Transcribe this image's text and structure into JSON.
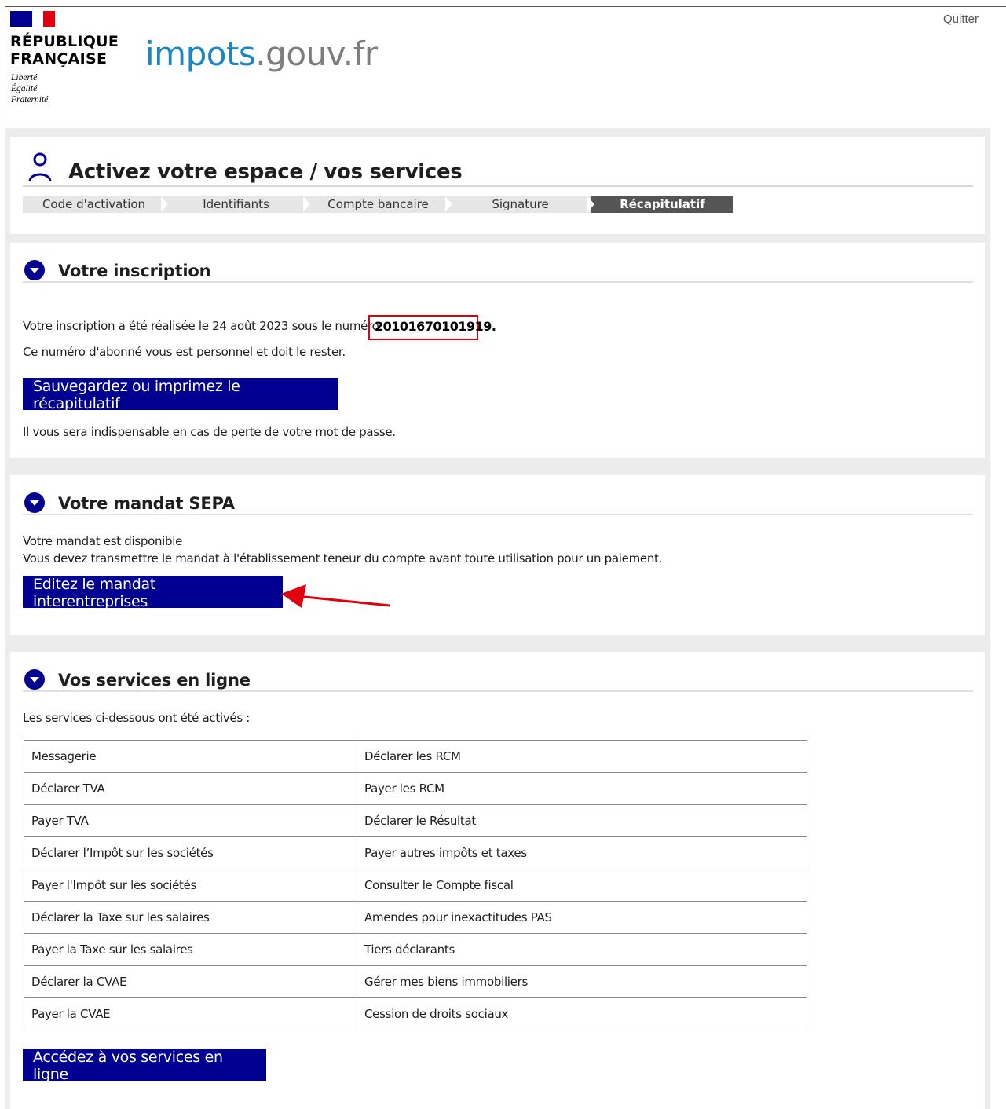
{
  "header": {
    "rf_name_line1": "RÉPUBLIQUE",
    "rf_name_line2": "FRANÇAISE",
    "motto_1": "Liberté",
    "motto_2": "Égalité",
    "motto_3": "Fraternité",
    "brand_impots": "impots",
    "brand_dot": ".",
    "brand_gouv": "gouv",
    "brand_fr": ".fr",
    "quit_link": "Quitter"
  },
  "activation": {
    "title": "Activez votre espace / vos services",
    "steps": [
      {
        "label": "Code d'activation",
        "active": false
      },
      {
        "label": "Identifiants",
        "active": false
      },
      {
        "label": "Compte bancaire",
        "active": false
      },
      {
        "label": "Signature",
        "active": false
      },
      {
        "label": "Récapitulatif",
        "active": true
      }
    ]
  },
  "inscription": {
    "title": "Votre inscription",
    "line1_prefix": "Votre inscription a été réalisée le 24 août 2023 sous le numéro",
    "number": "20101670101919.",
    "line2": "Ce numéro d'abonné vous est personnel et doit le rester.",
    "button": "Sauvegardez ou imprimez le récapitulatif",
    "note": "Il vous sera indispensable en cas de perte de votre mot de passe."
  },
  "mandat": {
    "title": "Votre mandat SEPA",
    "line1": "Votre mandat est disponible",
    "line2": "Vous devez transmettre le mandat à l'établissement teneur du compte avant toute utilisation pour un paiement.",
    "button": "Editez le mandat interentreprises"
  },
  "services": {
    "title": "Vos services en ligne",
    "intro": "Les services ci-dessous ont été activés :",
    "rows": [
      [
        "Messagerie",
        "Déclarer les RCM"
      ],
      [
        "Déclarer TVA",
        "Payer les RCM"
      ],
      [
        "Payer TVA",
        "Déclarer le Résultat"
      ],
      [
        "Déclarer l’Impôt sur les sociétés",
        "Payer autres impôts et taxes"
      ],
      [
        "Payer l'Impôt sur les sociétés",
        "Consulter le Compte fiscal"
      ],
      [
        "Déclarer la Taxe sur les salaires",
        "Amendes pour inexactitudes PAS"
      ],
      [
        "Payer la Taxe sur les salaires",
        "Tiers déclarants"
      ],
      [
        "Déclarer la CVAE",
        "Gérer mes biens immobiliers"
      ],
      [
        "Payer la CVAE",
        "Cession de droits sociaux"
      ]
    ],
    "button": "Accédez à vos services en ligne"
  },
  "colors": {
    "primary_button": "#000091",
    "highlight_box": "#e1000f",
    "arrow": "#e1000f",
    "step_active": "#555555",
    "step_inactive": "#e6e6e6",
    "brand_blue": "#1a86c8"
  }
}
